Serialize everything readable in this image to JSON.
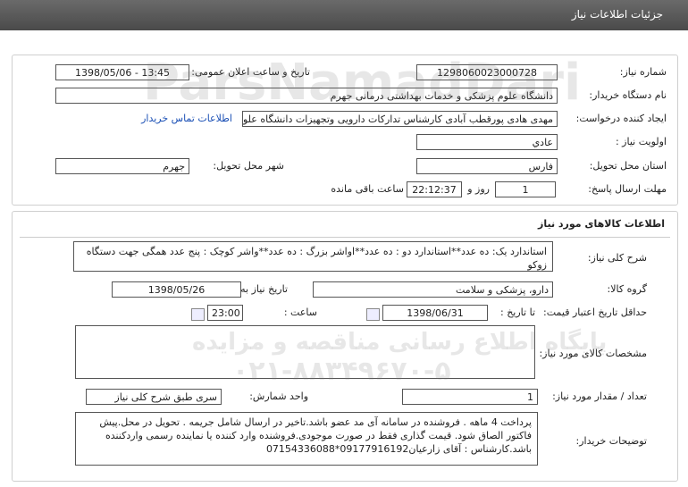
{
  "window": {
    "title": "جزئیات اطلاعات نیاز"
  },
  "need_info": {
    "need_number": {
      "label": "شماره نیاز:",
      "value": "1298060023000728"
    },
    "announce_datetime": {
      "label": "تاریخ و ساعت اعلان عمومی:",
      "value": "1398/05/06 - 13:45"
    },
    "buyer_org": {
      "label": "نام دستگاه خریدار:",
      "value": "دانشگاه علوم پزشکی و خدمات بهداشتی درمانی جهرم"
    },
    "requester": {
      "label": "ایجاد کننده درخواست:",
      "value": "مهدی هادی پورقطب آبادی کارشناس تدارکات دارویی وتجهیزات دانشگاه علوم پز",
      "contact_link": "اطلاعات تماس خریدار"
    },
    "priority": {
      "label": "اولویت نیاز :",
      "value": "عادي"
    },
    "delivery_province": {
      "label": "استان محل تحویل:",
      "value": "فارس"
    },
    "delivery_city": {
      "label": "شهر محل تحویل:",
      "value": "جهرم"
    },
    "response_deadline": {
      "label": "مهلت ارسال پاسخ:",
      "days": "1",
      "days_label": "روز و",
      "time": "22:12:37",
      "remaining_label": "ساعت باقی مانده"
    }
  },
  "goods_info": {
    "section_title": "اطلاعات کالاهای مورد نیاز",
    "general_desc": {
      "label": "شرح کلی نیاز:",
      "value": "استاندارد یک: ده عدد**استاندارد دو : ده عدد**اواشر بزرگ : ده عدد**واشر کوچک : پنج عدد همگی جهت دستگاه زوکو"
    },
    "goods_group": {
      "label": "گروه کالا:",
      "value": "دارو، پزشکی و سلامت"
    },
    "need_date": {
      "label": "تاریخ نیاز به کالا:",
      "value": "1398/05/26"
    },
    "price_validity": {
      "label": "حداقل تاریخ اعتبار قیمت:",
      "until_label": "تا تاریخ :",
      "date": "1398/06/31",
      "time_label": "ساعت :",
      "time": "23:00"
    },
    "goods_specs": {
      "label": "مشخصات کالای مورد نیاز:",
      "value": ""
    },
    "quantity": {
      "label": "تعداد / مقدار مورد نیاز:",
      "value": "1"
    },
    "unit": {
      "label": "واحد شمارش:",
      "value": "سری طبق شرح کلی نیاز"
    },
    "buyer_notes": {
      "label": "توضیحات خریدار:",
      "value": "پرداخت 4 ماهه . فروشنده در سامانه آی مد عضو باشد.تاخیر در ارسال شامل جریمه . تحویل در محل.پیش فاکتور الصاق شود. قیمت گذاری فقط در صورت موجودی.فروشنده وارد کننده یا نماینده رسمی واردکننده باشد.کارشناس : آقای زارعیان09177916192*07154336088"
    }
  },
  "watermark": {
    "line1": "پایگاه اطلاع رسانی مناقصه و مزایده",
    "line2": "۰۲۱-۸۸۳۴۹۶۷۰-۵",
    "brand": "ParsNamadDari"
  }
}
